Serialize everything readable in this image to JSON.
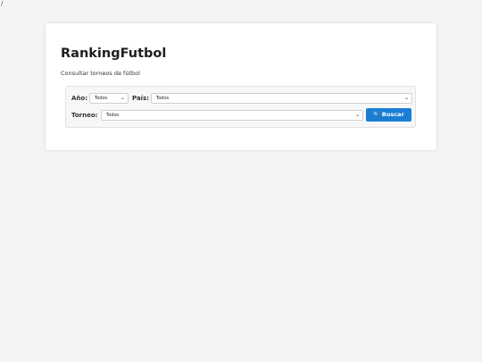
{
  "corner": "/",
  "header": {
    "title": "RankingFutbol",
    "subtitle": "Consultar torneos de fútbol"
  },
  "filters": {
    "year_label": "Año:",
    "year_value": "Todos",
    "country_label": "País:",
    "country_value": "Todos",
    "tournament_label": "Torneo:",
    "tournament_value": "Todos",
    "search_label": "Buscar"
  },
  "icons": {
    "search": "search-icon",
    "chevron": "chevron-down-icon"
  },
  "colors": {
    "accent": "#1a7fd4",
    "background": "#f4f4f4"
  }
}
